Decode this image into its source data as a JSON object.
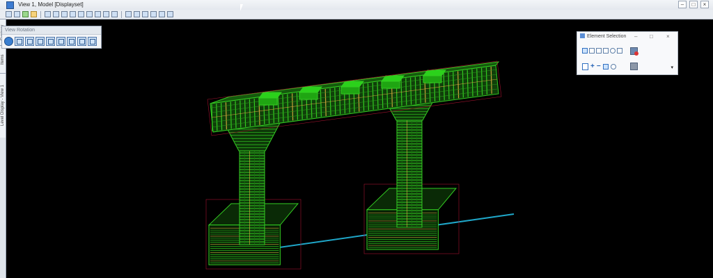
{
  "window": {
    "title": "View 1, Model [Displayset]",
    "controls": [
      "–",
      "□",
      "×"
    ]
  },
  "left_tabs": [
    "Explorer",
    "Items",
    "Level Display - View 1"
  ],
  "view_rotation": {
    "title": "View Rotation",
    "buttons": [
      "rotate-view",
      "top-view",
      "front-view",
      "right-view",
      "iso-view",
      "bottom-view",
      "back-view",
      "left-view",
      "iso-right-view"
    ]
  },
  "element_selection": {
    "title": "Element Selection",
    "controls": [
      "–",
      "□",
      "×"
    ],
    "dropdown_glyph": "▾"
  },
  "colors": {
    "background": "#000000",
    "rebar": "#33cc22",
    "rebar_highlight": "#c8a23a",
    "alignment": "#1fa7c9"
  }
}
